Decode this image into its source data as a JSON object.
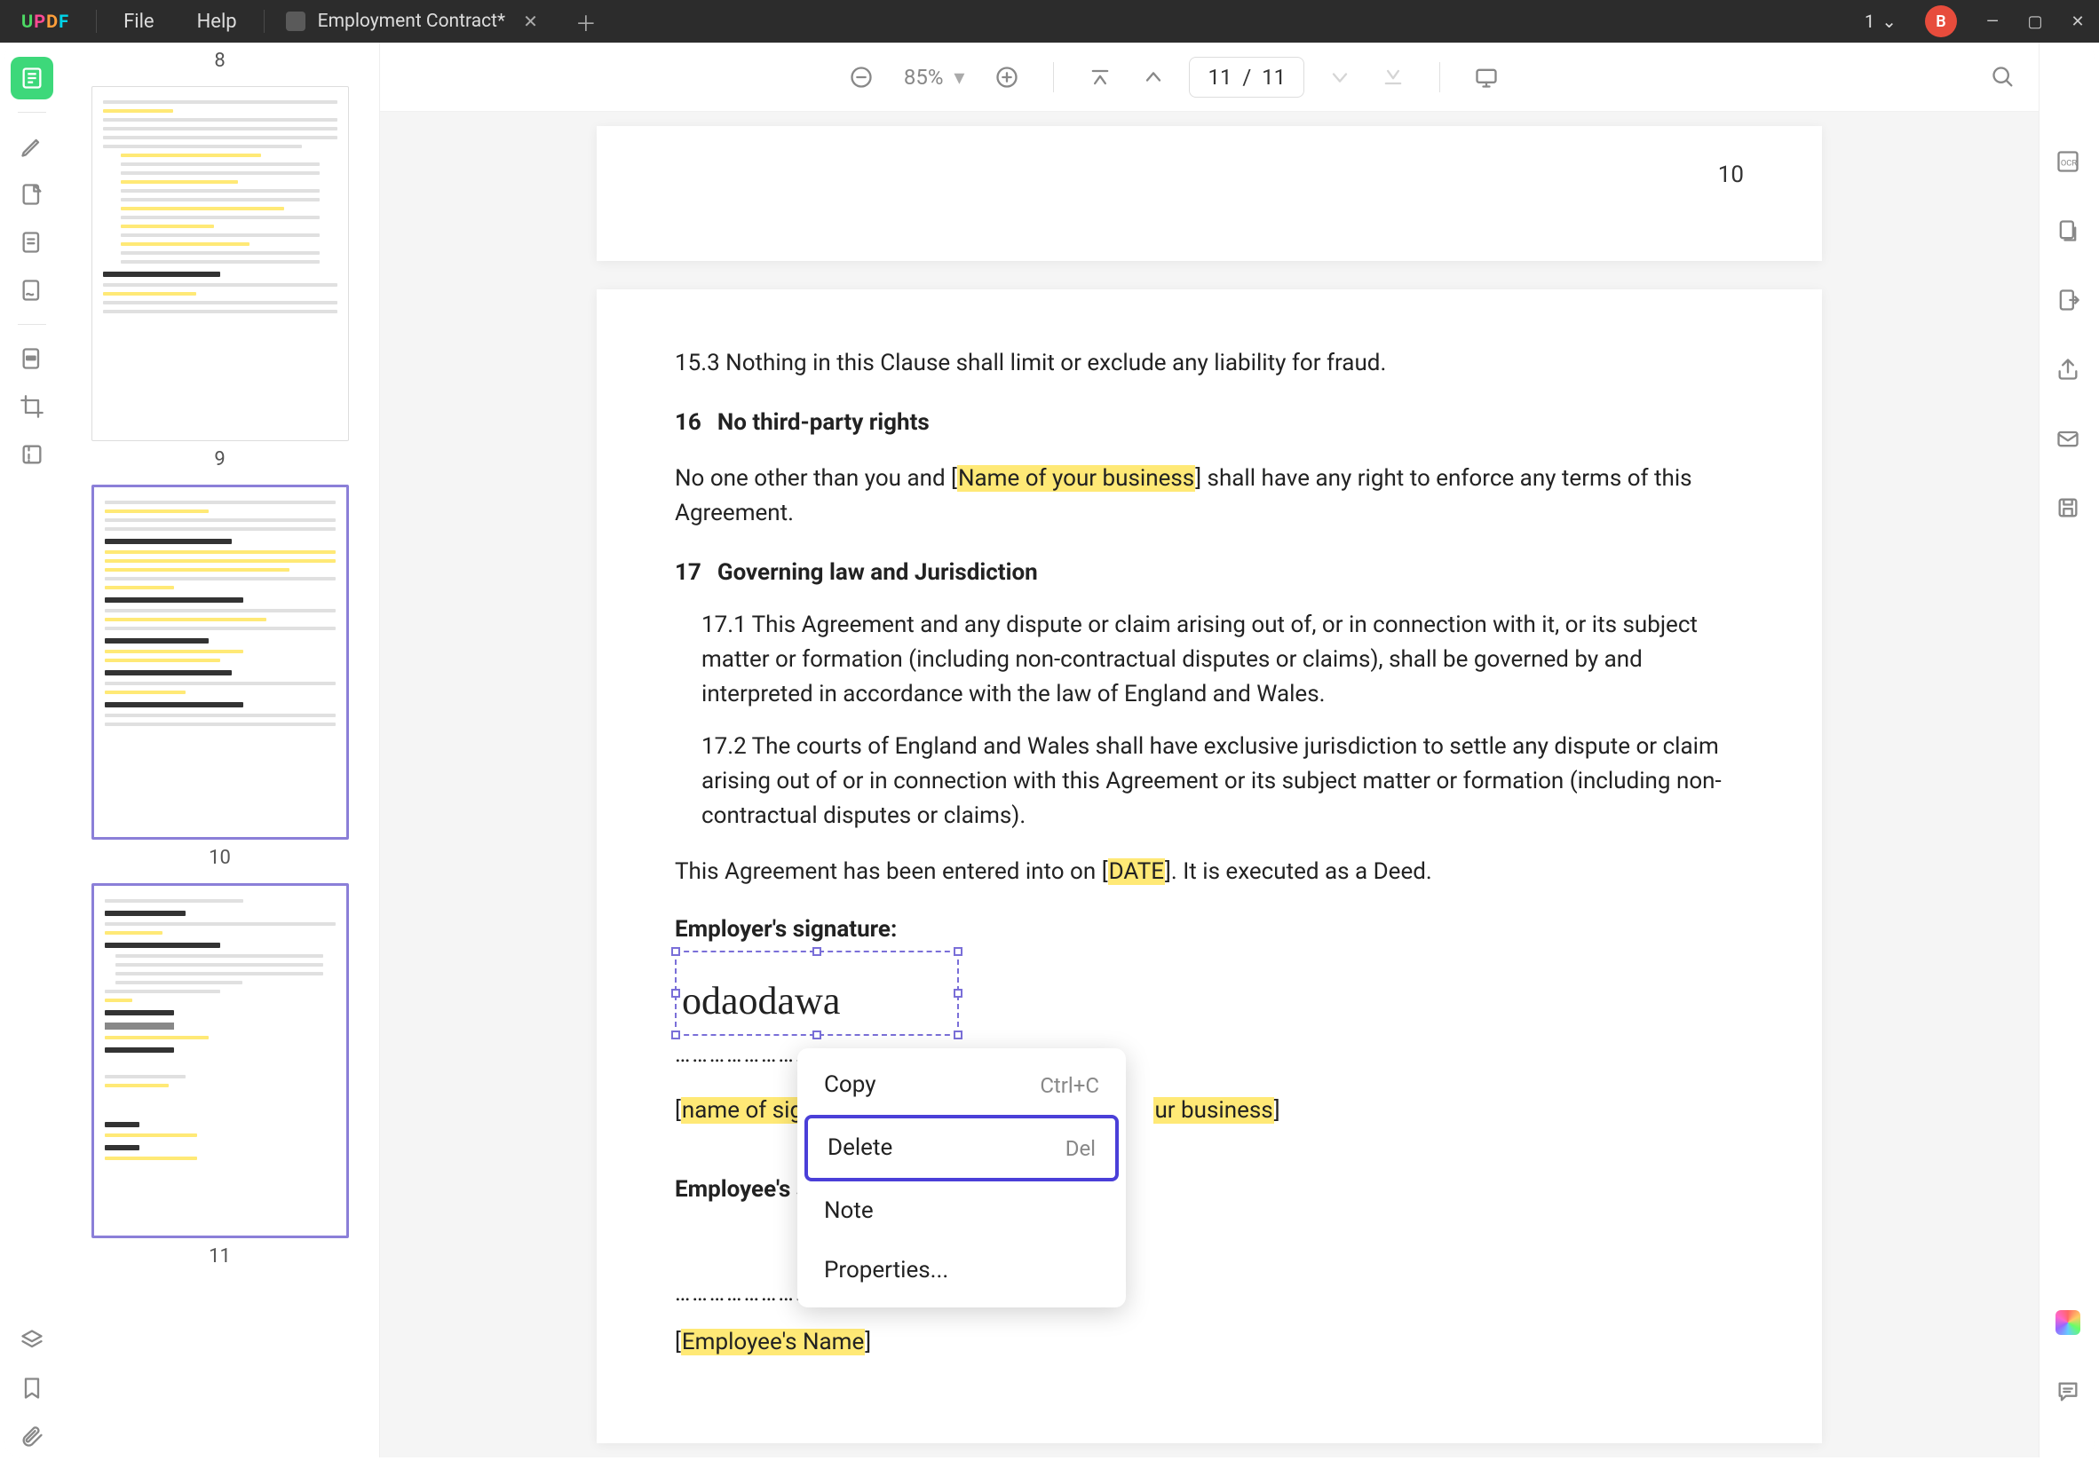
{
  "titlebar": {
    "menu_file": "File",
    "menu_help": "Help",
    "tab_title": "Employment Contract*",
    "page_indicator": "1",
    "user_initial": "B"
  },
  "toolbar": {
    "zoom": "85%",
    "page_current": "11",
    "page_sep": "/",
    "page_total": "11"
  },
  "thumbs": {
    "n8": "8",
    "n9": "9",
    "n10": "10",
    "n11": "11"
  },
  "page10": {
    "page_number": "10"
  },
  "doc": {
    "c15_3": "15.3   Nothing in this Clause shall limit or exclude any liability for fraud.",
    "s16_num": "16",
    "s16_title": "No third-party rights",
    "s16_body_pre": "No one other than you and [",
    "s16_hl": "Name of your business",
    "s16_body_post": "] shall have any right to enforce any terms of this Agreement.",
    "s17_num": "17",
    "s17_title": "Governing law and Jurisdiction",
    "c17_1": "17.1 This Agreement and any dispute or claim arising out of, or in connection with it, or its subject matter or formation (including non-contractual disputes or claims), shall be governed by and interpreted in accordance with the law of England and Wales.",
    "c17_2": "17.2 The courts of England and Wales shall have exclusive jurisdiction to settle any dispute or claim arising out of or in connection with this Agreement or its subject matter or formation (including non-contractual disputes or claims).",
    "entered_pre": "This Agreement has been entered into on [",
    "entered_hl": "DATE",
    "entered_post": "]. It is executed as a Deed.",
    "emp_sig_label": "Employer's signature:",
    "signature_text": "odaodawa",
    "dots1": "…………………………………………..",
    "signer_pre": "[",
    "signer_hl1": "name of sign",
    "signer_mid": "",
    "signer_hl2": "ur business",
    "signer_post": "]",
    "employee_sig_label_visible": "Employee's sig",
    "dots2": "…………………………………………..",
    "emp_name_pre": "[",
    "emp_name_hl": "Employee's Name",
    "emp_name_post": "]"
  },
  "ctx": {
    "copy": "Copy",
    "copy_short": "Ctrl+C",
    "delete": "Delete",
    "delete_short": "Del",
    "note": "Note",
    "properties": "Properties..."
  }
}
